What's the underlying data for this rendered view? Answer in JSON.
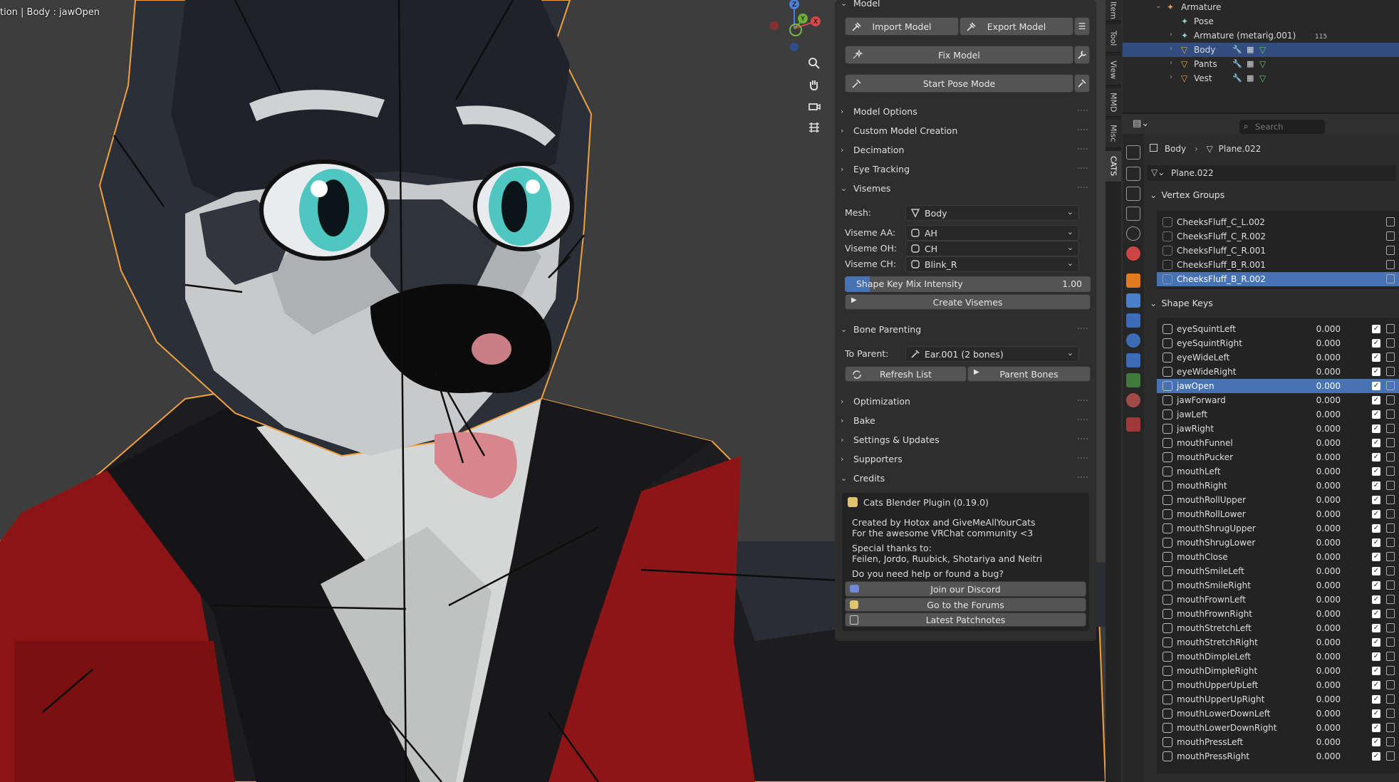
{
  "viewport": {
    "header_text": "tion | Body : jawOpen",
    "gizmo": {
      "x": "X",
      "y": "Y",
      "z": "Z"
    },
    "nav_buttons": [
      "zoom-icon",
      "pan-hand-icon",
      "camera-icon",
      "grid-icon"
    ]
  },
  "cats": {
    "top_section": "Model",
    "import_label": "Import Model",
    "export_label": "Export Model",
    "fix_label": "Fix Model",
    "pose_label": "Start Pose Mode",
    "sections_a": [
      "Model Options",
      "Custom Model Creation",
      "Decimation",
      "Eye Tracking"
    ],
    "visemes": {
      "title": "Visemes",
      "mesh_label": "Mesh:",
      "mesh_value": "Body",
      "aa_label": "Viseme AA:",
      "aa_value": "AH",
      "oh_label": "Viseme OH:",
      "oh_value": "CH",
      "ch_label": "Viseme CH:",
      "ch_value": "Blink_R",
      "slider_label": "Shape Key Mix Intensity",
      "slider_value": "1.00",
      "slider_fraction": 0.1,
      "create_label": "Create Visemes"
    },
    "bone": {
      "title": "Bone Parenting",
      "parent_label": "To Parent:",
      "parent_value": "Ear.001 (2 bones)",
      "refresh_label": "Refresh List",
      "parent_bones_label": "Parent Bones"
    },
    "sections_b": [
      "Optimization",
      "Bake",
      "Settings & Updates",
      "Supporters"
    ],
    "credits": {
      "title": "Credits",
      "plugin": "Cats Blender Plugin (0.19.0)",
      "line1": "Created by Hotox and GiveMeAllYourCats",
      "line2": "For the awesome VRChat community <3",
      "line3": "Special thanks to:",
      "line4": "Feilen, Jordo, Ruubick, Shotariya and Neitri",
      "line5": "Do you need help or found a bug?",
      "discord": "Join our Discord",
      "forums": "Go to the Forums",
      "patch": "Latest Patchnotes"
    }
  },
  "vtabs": [
    "Item",
    "Tool",
    "View",
    "MMD",
    "Misc",
    "CATS"
  ],
  "outliner": {
    "rows": [
      {
        "label": "Armature",
        "indent": 0
      },
      {
        "label": "Pose",
        "indent": 1
      },
      {
        "label": "Armature (metarig.001)",
        "indent": 1,
        "extra": "115"
      },
      {
        "label": "Body",
        "indent": 1,
        "selected": true
      },
      {
        "label": "Pants",
        "indent": 1
      },
      {
        "label": "Vest",
        "indent": 1
      }
    ]
  },
  "props": {
    "search_placeholder": "Search",
    "breadcrumb_obj": "Body",
    "breadcrumb_mesh": "Plane.022",
    "mesh_name": "Plane.022",
    "vg_title": "Vertex Groups",
    "vertex_groups": [
      "CheeksFluff_C_L.002",
      "CheeksFluff_C_R.002",
      "CheeksFluff_C_R.001",
      "CheeksFluff_B_R.001",
      "CheeksFluff_B_R.002"
    ],
    "vg_selected": 4,
    "sk_title": "Shape Keys",
    "shape_keys": [
      {
        "name": "eyeSquintLeft",
        "value": "0.000"
      },
      {
        "name": "eyeSquintRight",
        "value": "0.000"
      },
      {
        "name": "eyeWideLeft",
        "value": "0.000"
      },
      {
        "name": "eyeWideRight",
        "value": "0.000"
      },
      {
        "name": "jawOpen",
        "value": "0.000"
      },
      {
        "name": "jawForward",
        "value": "0.000"
      },
      {
        "name": "jawLeft",
        "value": "0.000"
      },
      {
        "name": "jawRight",
        "value": "0.000"
      },
      {
        "name": "mouthFunnel",
        "value": "0.000"
      },
      {
        "name": "mouthPucker",
        "value": "0.000"
      },
      {
        "name": "mouthLeft",
        "value": "0.000"
      },
      {
        "name": "mouthRight",
        "value": "0.000"
      },
      {
        "name": "mouthRollUpper",
        "value": "0.000"
      },
      {
        "name": "mouthRollLower",
        "value": "0.000"
      },
      {
        "name": "mouthShrugUpper",
        "value": "0.000"
      },
      {
        "name": "mouthShrugLower",
        "value": "0.000"
      },
      {
        "name": "mouthClose",
        "value": "0.000"
      },
      {
        "name": "mouthSmileLeft",
        "value": "0.000"
      },
      {
        "name": "mouthSmileRight",
        "value": "0.000"
      },
      {
        "name": "mouthFrownLeft",
        "value": "0.000"
      },
      {
        "name": "mouthFrownRight",
        "value": "0.000"
      },
      {
        "name": "mouthStretchLeft",
        "value": "0.000"
      },
      {
        "name": "mouthStretchRight",
        "value": "0.000"
      },
      {
        "name": "mouthDimpleLeft",
        "value": "0.000"
      },
      {
        "name": "mouthDimpleRight",
        "value": "0.000"
      },
      {
        "name": "mouthUpperUpLeft",
        "value": "0.000"
      },
      {
        "name": "mouthUpperUpRight",
        "value": "0.000"
      },
      {
        "name": "mouthLowerDownLeft",
        "value": "0.000"
      },
      {
        "name": "mouthLowerDownRight",
        "value": "0.000"
      },
      {
        "name": "mouthPressLeft",
        "value": "0.000"
      },
      {
        "name": "mouthPressRight",
        "value": "0.000"
      }
    ],
    "sk_selected": 4
  },
  "colors": {
    "accent": "#4772b3",
    "selected_row": "#334d80",
    "outline": "#f29c38",
    "jacket_red": "#8b1414"
  }
}
